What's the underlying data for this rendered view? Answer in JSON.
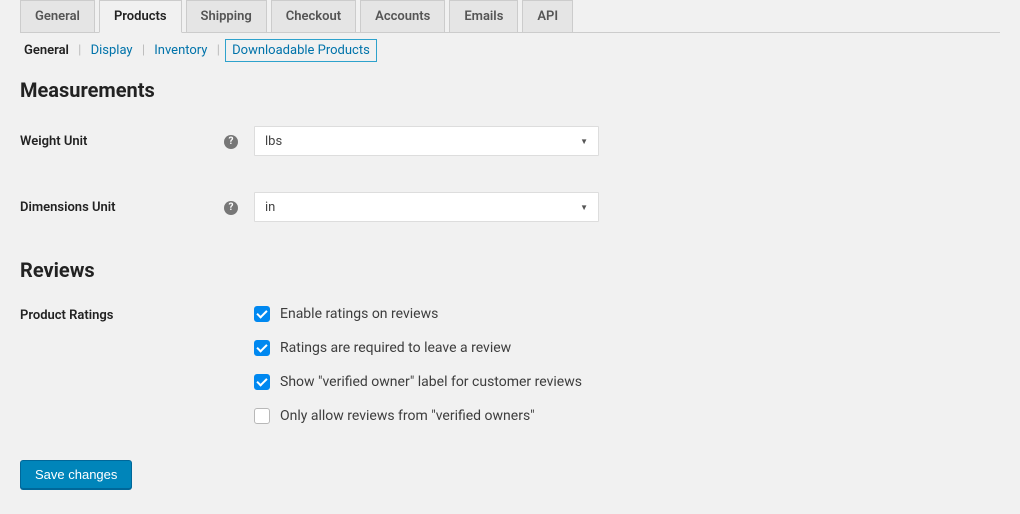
{
  "tabs": {
    "items": [
      {
        "label": "General"
      },
      {
        "label": "Products"
      },
      {
        "label": "Shipping"
      },
      {
        "label": "Checkout"
      },
      {
        "label": "Accounts"
      },
      {
        "label": "Emails"
      },
      {
        "label": "API"
      }
    ],
    "active_index": 1
  },
  "subtabs": {
    "items": [
      {
        "label": "General"
      },
      {
        "label": "Display"
      },
      {
        "label": "Inventory"
      },
      {
        "label": "Downloadable Products"
      }
    ],
    "active_index": 0,
    "highlight_index": 3
  },
  "sections": {
    "measurements": {
      "title": "Measurements",
      "weight_unit": {
        "label": "Weight Unit",
        "value": "lbs"
      },
      "dimensions_unit": {
        "label": "Dimensions Unit",
        "value": "in"
      }
    },
    "reviews": {
      "title": "Reviews",
      "product_ratings": {
        "label": "Product Ratings",
        "options": [
          {
            "label": "Enable ratings on reviews",
            "checked": true
          },
          {
            "label": "Ratings are required to leave a review",
            "checked": true
          },
          {
            "label": "Show \"verified owner\" label for customer reviews",
            "checked": true
          },
          {
            "label": "Only allow reviews from \"verified owners\"",
            "checked": false
          }
        ]
      }
    }
  },
  "actions": {
    "save_label": "Save changes"
  }
}
